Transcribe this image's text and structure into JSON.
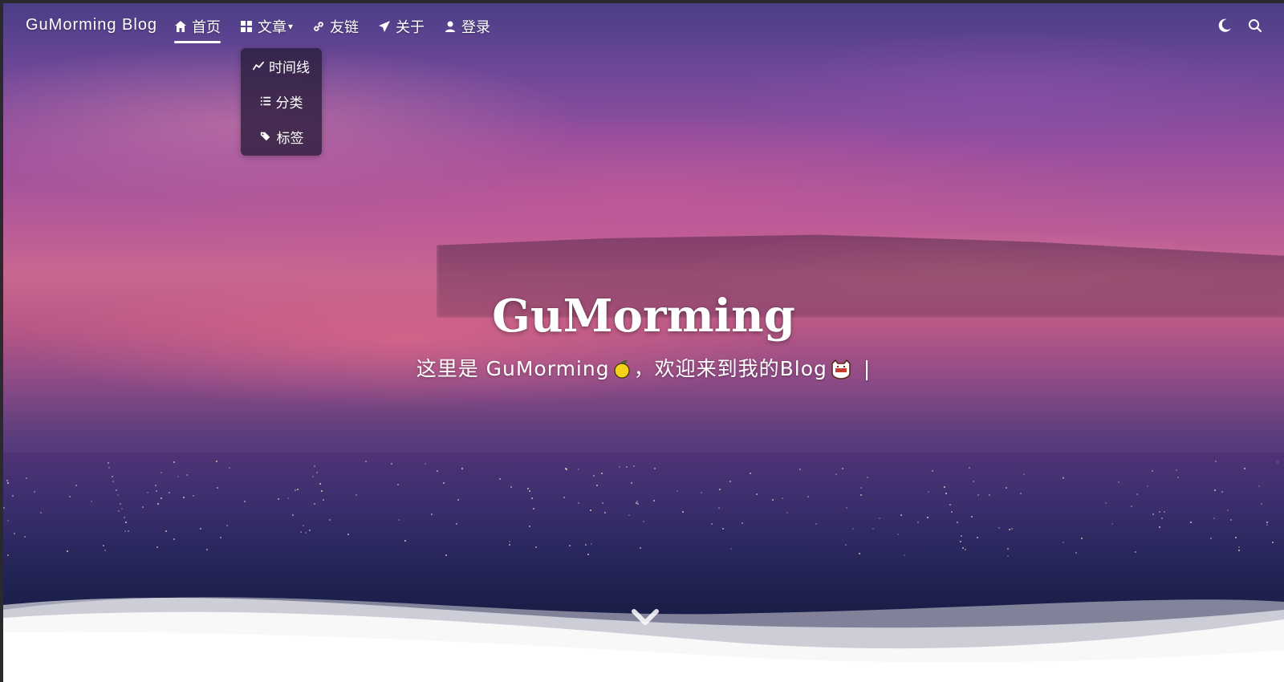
{
  "nav": {
    "brand": "GuMorming Blog",
    "items": [
      {
        "label": "首页",
        "icon": "home-icon",
        "active": true
      },
      {
        "label": "文章",
        "icon": "grid-icon",
        "dropdown": true
      },
      {
        "label": "友链",
        "icon": "link-icon"
      },
      {
        "label": "关于",
        "icon": "paper-plane-icon"
      },
      {
        "label": "登录",
        "icon": "user-icon"
      }
    ],
    "dropdown_items": [
      {
        "label": "时间线",
        "icon": "timeline-icon"
      },
      {
        "label": "分类",
        "icon": "list-icon"
      },
      {
        "label": "标签",
        "icon": "tags-icon"
      }
    ],
    "right_icons": [
      "dark-mode-icon",
      "search-icon"
    ]
  },
  "hero": {
    "title": "GuMorming",
    "subtitle_a": "这里是 GuMorming",
    "subtitle_b": "，欢迎来到我的Blog",
    "cursor": "|",
    "emoji_1": "lemon-emoji",
    "emoji_2": "cat-emoji"
  },
  "scroll": {
    "icon": "chevron-down-icon"
  }
}
